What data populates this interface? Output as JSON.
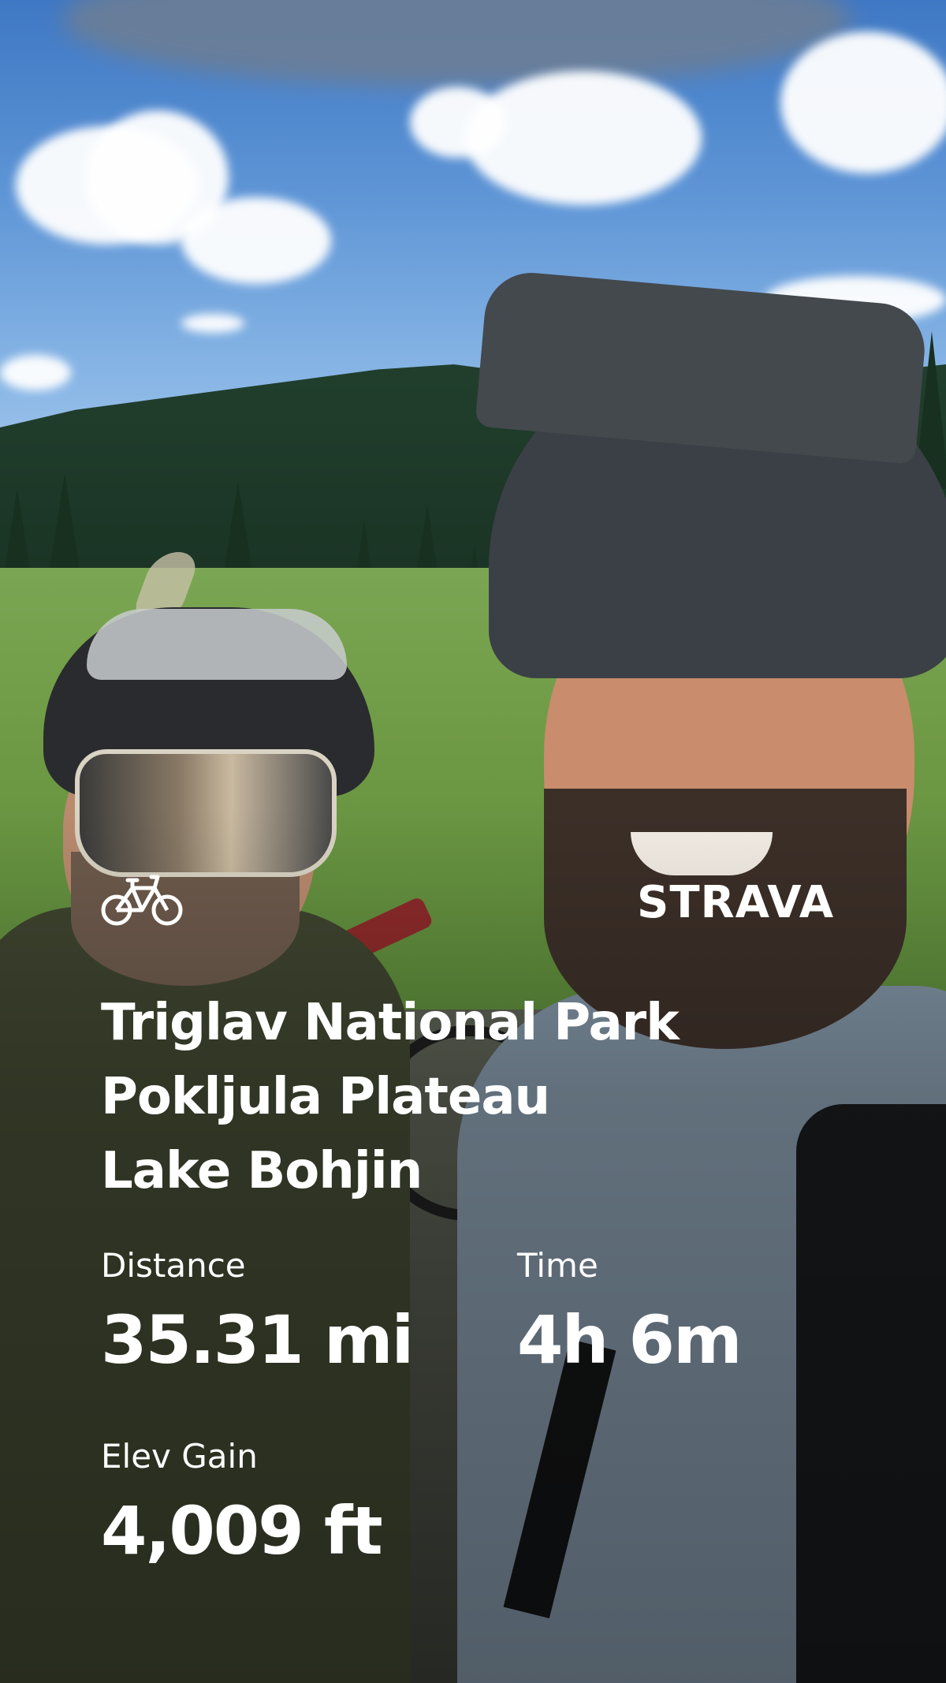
{
  "activity": {
    "icon": "bicycle-icon",
    "brand": "STRAVA",
    "title_lines": [
      "Triglav National Park",
      "Pokljula Plateau",
      "Lake Bohjin"
    ]
  },
  "stats": {
    "distance": {
      "label": "Distance",
      "value": "35.31 mi"
    },
    "time": {
      "label": "Time",
      "value": "4h 6m"
    },
    "elev_gain": {
      "label": "Elev Gain",
      "value": "4,009 ft"
    }
  },
  "colors": {
    "text": "#ffffff",
    "sky": "#5e95d6",
    "meadow": "#6f9a45"
  }
}
